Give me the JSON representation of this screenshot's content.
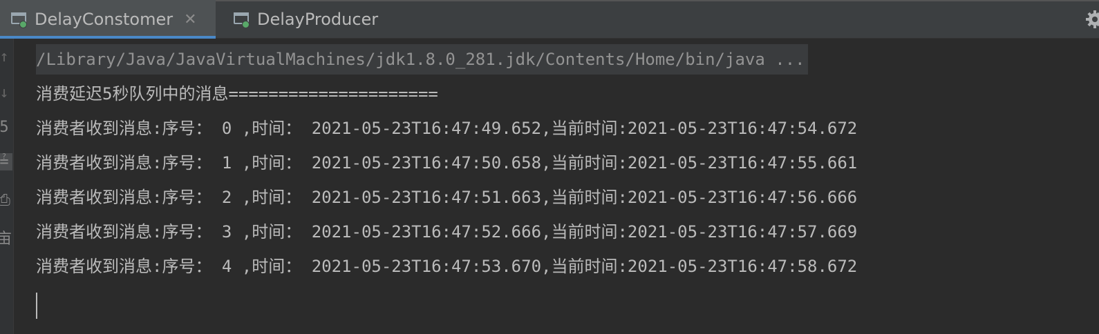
{
  "tabs": [
    {
      "label": "DelayConstomer",
      "active": true
    },
    {
      "label": "DelayProducer",
      "active": false
    }
  ],
  "gutter_glyphs": [
    "↑",
    "↓",
    "5",
    "≟",
    "⎙",
    "亩"
  ],
  "console": {
    "command": "/Library/Java/JavaVirtualMachines/jdk1.8.0_281.jdk/Contents/Home/bin/java ...",
    "header": "消费延迟5秒队列中的消息=====================",
    "lines": [
      "消费者收到消息:序号： 0 ,时间： 2021-05-23T16:47:49.652,当前时间:2021-05-23T16:47:54.672",
      "消费者收到消息:序号： 1 ,时间： 2021-05-23T16:47:50.658,当前时间:2021-05-23T16:47:55.661",
      "消费者收到消息:序号： 2 ,时间： 2021-05-23T16:47:51.663,当前时间:2021-05-23T16:47:56.666",
      "消费者收到消息:序号： 3 ,时间： 2021-05-23T16:47:52.666,当前时间:2021-05-23T16:47:57.669",
      "消费者收到消息:序号： 4 ,时间： 2021-05-23T16:47:53.670,当前时间:2021-05-23T16:47:58.672"
    ]
  },
  "colors": {
    "tab_accent": "#4a88c7",
    "console_bg": "#2b2b2b",
    "text": "#bbbbbb"
  }
}
